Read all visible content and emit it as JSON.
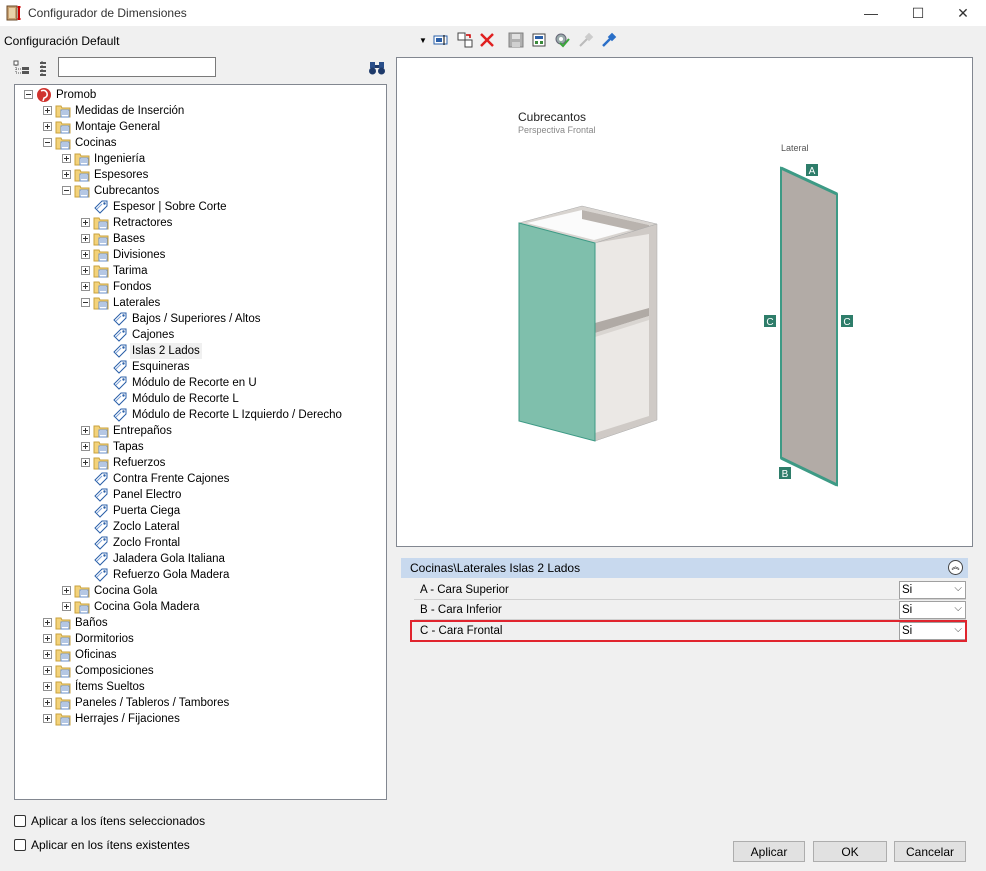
{
  "window": {
    "title": "Configurador de Dimensiones",
    "minimize": "—",
    "maximize": "☐",
    "close": "✕"
  },
  "config": {
    "selected": "Configuración Default"
  },
  "search": {
    "value": ""
  },
  "tree": [
    {
      "label": "Promob",
      "level": 0,
      "exp": "minus",
      "icon": "globe"
    },
    {
      "label": "Medidas de Inserción",
      "level": 1,
      "exp": "plus",
      "icon": "folder"
    },
    {
      "label": "Montaje General",
      "level": 1,
      "exp": "plus",
      "icon": "folder"
    },
    {
      "label": "Cocinas",
      "level": 1,
      "exp": "minus",
      "icon": "folder"
    },
    {
      "label": "Ingeniería",
      "level": 2,
      "exp": "plus",
      "icon": "folder"
    },
    {
      "label": "Espesores",
      "level": 2,
      "exp": "plus",
      "icon": "folder"
    },
    {
      "label": "Cubrecantos",
      "level": 2,
      "exp": "minus",
      "icon": "folder"
    },
    {
      "label": "Espesor | Sobre Corte",
      "level": 3,
      "exp": "",
      "icon": "tag"
    },
    {
      "label": "Retractores",
      "level": 3,
      "exp": "plus",
      "icon": "folder"
    },
    {
      "label": "Bases",
      "level": 3,
      "exp": "plus",
      "icon": "folder"
    },
    {
      "label": "Divisiones",
      "level": 3,
      "exp": "plus",
      "icon": "folder"
    },
    {
      "label": "Tarima",
      "level": 3,
      "exp": "plus",
      "icon": "folder"
    },
    {
      "label": "Fondos",
      "level": 3,
      "exp": "plus",
      "icon": "folder"
    },
    {
      "label": "Laterales",
      "level": 3,
      "exp": "minus",
      "icon": "folder"
    },
    {
      "label": "Bajos / Superiores / Altos",
      "level": 4,
      "exp": "",
      "icon": "tag"
    },
    {
      "label": "Cajones",
      "level": 4,
      "exp": "",
      "icon": "tag"
    },
    {
      "label": "Islas 2 Lados",
      "level": 4,
      "exp": "",
      "icon": "tag",
      "selected": true
    },
    {
      "label": "Esquineras",
      "level": 4,
      "exp": "",
      "icon": "tag"
    },
    {
      "label": "Módulo de Recorte en U",
      "level": 4,
      "exp": "",
      "icon": "tag"
    },
    {
      "label": "Módulo de Recorte L",
      "level": 4,
      "exp": "",
      "icon": "tag"
    },
    {
      "label": "Módulo de Recorte L Izquierdo / Derecho",
      "level": 4,
      "exp": "",
      "icon": "tag"
    },
    {
      "label": "Entrepaños",
      "level": 3,
      "exp": "plus",
      "icon": "folder"
    },
    {
      "label": "Tapas",
      "level": 3,
      "exp": "plus",
      "icon": "folder"
    },
    {
      "label": "Refuerzos",
      "level": 3,
      "exp": "plus",
      "icon": "folder"
    },
    {
      "label": "Contra Frente Cajones",
      "level": 3,
      "exp": "",
      "icon": "tag"
    },
    {
      "label": "Panel Electro",
      "level": 3,
      "exp": "",
      "icon": "tag"
    },
    {
      "label": "Puerta Ciega",
      "level": 3,
      "exp": "",
      "icon": "tag"
    },
    {
      "label": "Zoclo Lateral",
      "level": 3,
      "exp": "",
      "icon": "tag"
    },
    {
      "label": "Zoclo Frontal",
      "level": 3,
      "exp": "",
      "icon": "tag"
    },
    {
      "label": "Jaladera Gola Italiana",
      "level": 3,
      "exp": "",
      "icon": "tag"
    },
    {
      "label": "Refuerzo Gola Madera",
      "level": 3,
      "exp": "",
      "icon": "tag"
    },
    {
      "label": "Cocina Gola",
      "level": 2,
      "exp": "plus",
      "icon": "folder"
    },
    {
      "label": "Cocina Gola Madera",
      "level": 2,
      "exp": "plus",
      "icon": "folder"
    },
    {
      "label": "Baños",
      "level": 1,
      "exp": "plus",
      "icon": "folder"
    },
    {
      "label": "Dormitorios",
      "level": 1,
      "exp": "plus",
      "icon": "folder"
    },
    {
      "label": "Oficinas",
      "level": 1,
      "exp": "plus",
      "icon": "folder"
    },
    {
      "label": "Composiciones",
      "level": 1,
      "exp": "plus",
      "icon": "folder"
    },
    {
      "label": "Ítems Sueltos",
      "level": 1,
      "exp": "plus",
      "icon": "folder"
    },
    {
      "label": "Paneles / Tableros / Tambores",
      "level": 1,
      "exp": "plus",
      "icon": "folder"
    },
    {
      "label": "Herrajes / Fijaciones",
      "level": 1,
      "exp": "plus",
      "icon": "folder"
    }
  ],
  "checks": [
    {
      "label": "Aplicar a los ítens seleccionados",
      "checked": false
    },
    {
      "label": "Aplicar en los ítens existentes",
      "checked": false
    }
  ],
  "preview": {
    "title": "Cubrecantos",
    "subtitle": "Perspectiva Frontal",
    "lateral_label": "Lateral",
    "marker_a": "A",
    "marker_b": "B",
    "marker_c": "C",
    "colors": {
      "edge": "#3d9a85",
      "panel": "#b2aba6",
      "front": "#7fbfac"
    }
  },
  "props": {
    "header": "Cocinas\\Laterales Islas 2 Lados",
    "rows": [
      {
        "name": "A - Cara Superior",
        "value": "Si"
      },
      {
        "name": "B - Cara Inferior",
        "value": "Si"
      },
      {
        "name": "C - Cara Frontal",
        "value": "Si"
      }
    ]
  },
  "buttons": {
    "apply": "Aplicar",
    "ok": "OK",
    "cancel": "Cancelar"
  }
}
